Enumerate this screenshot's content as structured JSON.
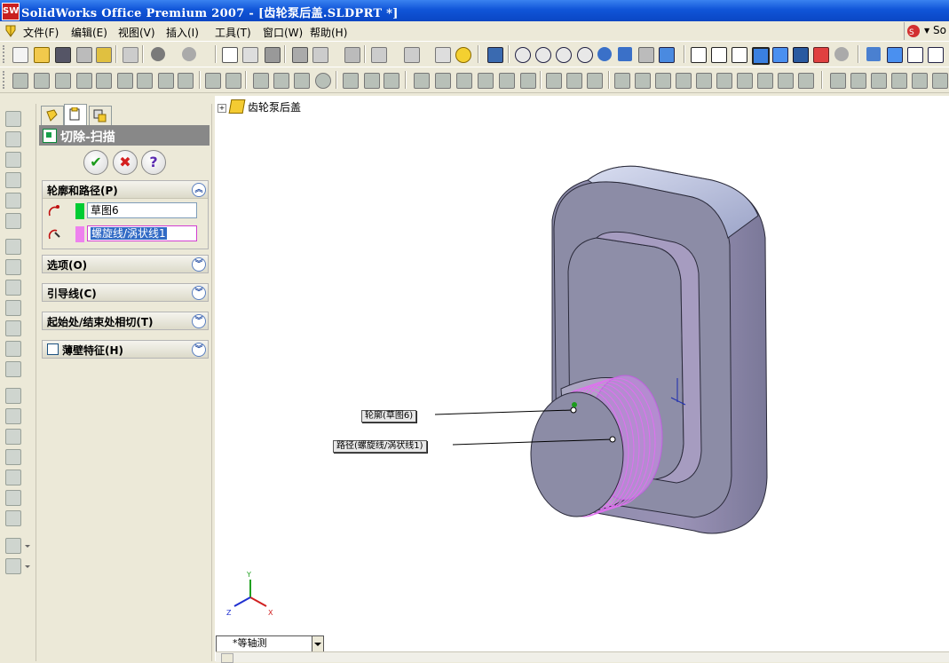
{
  "window": {
    "title": "SolidWorks Office Premium 2007 - [齿轮泵后盖.SLDPRT *]",
    "app_icon_label": "SW"
  },
  "menu": {
    "items": [
      "文件(F)",
      "编辑(E)",
      "视图(V)",
      "插入(I)",
      "工具(T)",
      "窗口(W)",
      "帮助(H)"
    ],
    "right_label": "So"
  },
  "feature_panel": {
    "title": "切除-扫描",
    "ok_label": "✔",
    "cancel_label": "✖",
    "help_label": "?",
    "groups": {
      "profile_path": "轮廓和路径(P)",
      "options": "选项(O)",
      "guide_curves": "引导线(C)",
      "start_end_tangency": "起始处/结束处相切(T)",
      "thin_feature": "薄壁特征(H)"
    },
    "profile_value": "草图6",
    "path_value": "螺旋线/涡状线1",
    "profile_color": "#00cc33",
    "path_color": "#ee82ee"
  },
  "viewport": {
    "tree_item": "齿轮泵后盖",
    "callout_profile": "轮廓(草图6)",
    "callout_path": "路径(螺旋线/涡状线1)",
    "view_orientation": "*等轴测",
    "axis_labels": {
      "x": "X",
      "y": "Y",
      "z": "Z"
    }
  }
}
